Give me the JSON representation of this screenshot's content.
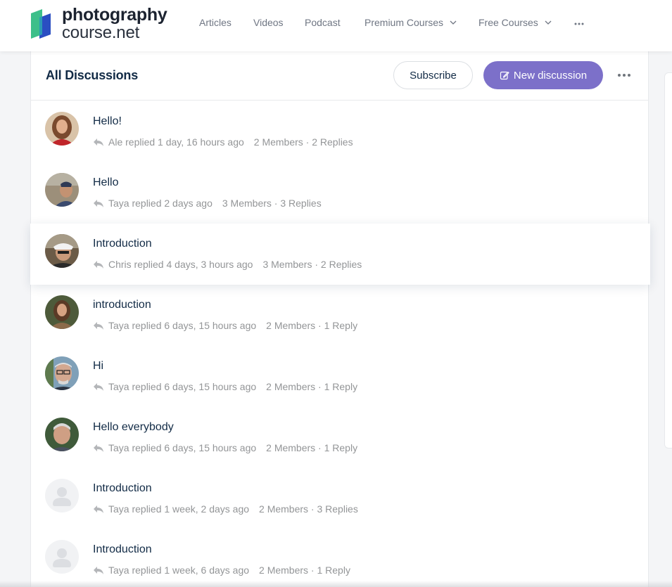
{
  "brand": {
    "line1": "photography",
    "line2": "course.net",
    "colors": {
      "mark_green": "#3dbf8a",
      "mark_blue": "#2a4ec2",
      "mark_teal": "#2b9bb5"
    }
  },
  "nav": {
    "items": [
      {
        "label": "Articles"
      },
      {
        "label": "Videos"
      },
      {
        "label": "Podcast"
      },
      {
        "label": "Premium Courses",
        "icon": "chevron-down-icon"
      },
      {
        "label": "Free Courses",
        "icon": "chevron-down-icon"
      }
    ],
    "more_icon": "more-dots-icon"
  },
  "discussions": {
    "title": "All Discussions",
    "subscribe_label": "Subscribe",
    "new_label": "New discussion",
    "accent": "#7c70c9",
    "items": [
      {
        "title": "Hello!",
        "replier": "Ale replied 1 day, 16 hours ago",
        "stats": "2 Members · 2 Replies"
      },
      {
        "title": "Hello",
        "replier": "Taya replied 2 days ago",
        "stats": "3 Members · 3 Replies"
      },
      {
        "title": "Introduction",
        "replier": "Chris replied 4 days, 3 hours ago",
        "stats": "3 Members · 2 Replies"
      },
      {
        "title": "introduction",
        "replier": "Taya replied 6 days, 15 hours ago",
        "stats": "2 Members · 1 Reply"
      },
      {
        "title": "Hi",
        "replier": "Taya replied 6 days, 15 hours ago",
        "stats": "2 Members · 1 Reply"
      },
      {
        "title": "Hello everybody",
        "replier": "Taya replied 6 days, 15 hours ago",
        "stats": "2 Members · 1 Reply"
      },
      {
        "title": "Introduction",
        "replier": "Taya replied 1 week, 2 days ago",
        "stats": "2 Members · 3 Replies"
      },
      {
        "title": "Introduction",
        "replier": "Taya replied 1 week, 6 days ago",
        "stats": "2 Members · 1 Reply"
      }
    ]
  }
}
